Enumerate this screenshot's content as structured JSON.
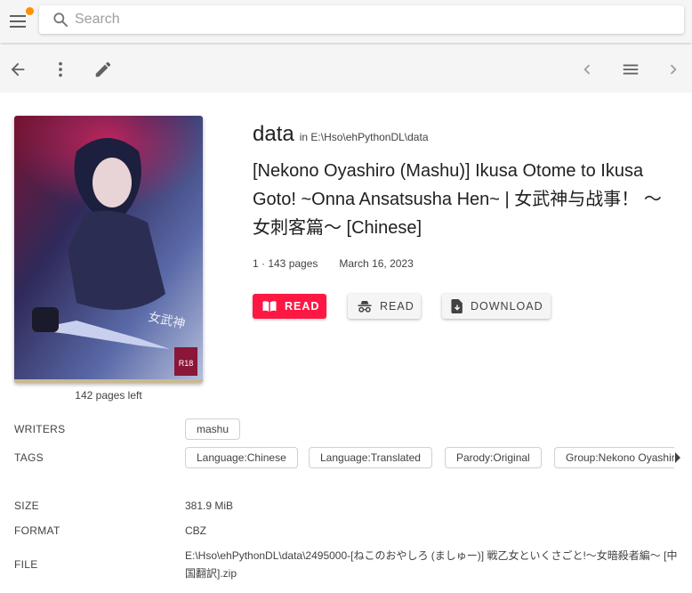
{
  "topbar": {
    "search": {
      "placeholder": "Search",
      "value": ""
    },
    "notification_color": "#ff8f00"
  },
  "toolbar": {
    "left_icons": [
      "arrow-back-icon",
      "more-vert-icon",
      "edit-icon"
    ],
    "right_icons": [
      "chevron-left-icon",
      "menu-icon",
      "chevron-right-icon"
    ]
  },
  "book": {
    "library": "data",
    "library_path_prefix": "in",
    "library_path": "E:\\Hso\\ehPythonDL\\data",
    "title": "[Nekono Oyashiro (Mashu)] Ikusa Otome to Ikusa Goto! ~Onna Ansatsusha Hen~ | 女武神与战事！ ～女刺客篇～ [Chinese]",
    "pages_info": "1 · 143 pages",
    "date": "March 16, 2023",
    "pages_left": "142 pages left"
  },
  "actions": {
    "read_label": "READ",
    "incognito_read_label": "READ",
    "download_label": "DOWNLOAD",
    "accent_color": "#ff1744"
  },
  "details": {
    "writers_label": "WRITERS",
    "writers": [
      "mashu"
    ],
    "tags_label": "TAGS",
    "tags": [
      "Language:Chinese",
      "Language:Translated",
      "Parody:Original",
      "Group:Nekono Oyashiro"
    ],
    "size_label": "SIZE",
    "size": "381.9 MiB",
    "format_label": "FORMAT",
    "format": "CBZ",
    "file_label": "FILE",
    "file": "E:\\Hso\\ehPythonDL\\data\\2495000-[ねこのおやしろ (ましゅー)] 戦乙女といくさごと!～女暗殺者編～ [中国翻訳].zip"
  }
}
